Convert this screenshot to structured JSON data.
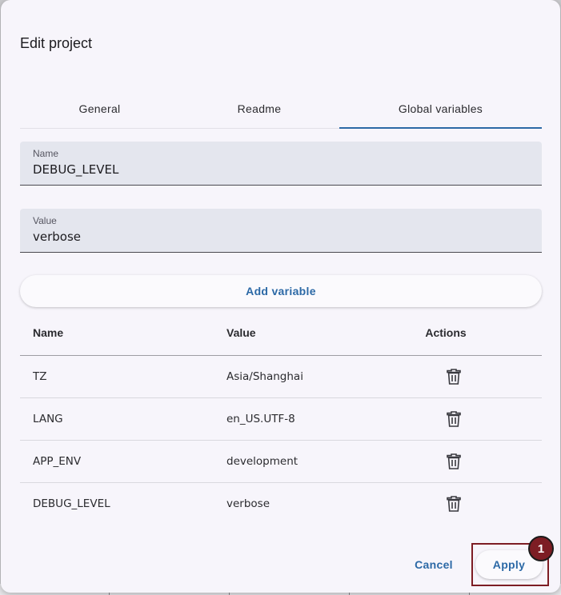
{
  "dialog": {
    "title": "Edit project"
  },
  "tabs": [
    {
      "label": "General"
    },
    {
      "label": "Readme"
    },
    {
      "label": "Global variables"
    }
  ],
  "form": {
    "name": {
      "label": "Name",
      "value": "DEBUG_LEVEL"
    },
    "value": {
      "label": "Value",
      "value": "verbose"
    },
    "add_label": "Add variable"
  },
  "table": {
    "headers": {
      "name": "Name",
      "value": "Value",
      "actions": "Actions"
    },
    "rows": [
      {
        "name": "TZ",
        "value": "Asia/Shanghai"
      },
      {
        "name": "LANG",
        "value": "en_US.UTF-8"
      },
      {
        "name": "APP_ENV",
        "value": "development"
      },
      {
        "name": "DEBUG_LEVEL",
        "value": "verbose"
      }
    ],
    "action_icon": "trash-icon"
  },
  "footer": {
    "cancel_label": "Cancel",
    "apply_label": "Apply"
  },
  "annotation": {
    "badge": "1"
  },
  "colors": {
    "accent": "#2c69a6",
    "highlight": "#7d1d24"
  }
}
